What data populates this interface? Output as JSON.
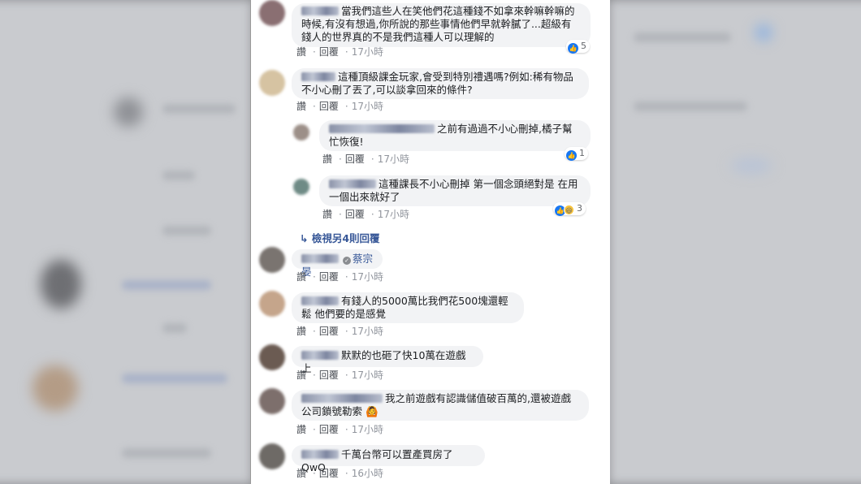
{
  "actions": {
    "like": "讚",
    "reply": "回覆"
  },
  "comments": [
    {
      "text": "當我們這些人在笑他們花這種錢不如拿來幹嘛幹嘛的時候,有沒有想過,你所說的那些事情他們早就幹膩了...超級有錢人的世界真的不是我們這種人可以理解的",
      "time": "17小時",
      "reactions": "5"
    },
    {
      "text": "這種頂級課金玩家,會受到特別禮遇嗎?例如:稀有物品不小心刪了丟了,可以談拿回來的條件?",
      "time": "17小時"
    },
    {
      "text": "之前有過過不小心刪掉,橘子幫忙恢復!",
      "time": "17小時",
      "reactions": "1"
    },
    {
      "text": "這種課長不小心刪掉 第一個念頭絕對是 在用一個出來就好了",
      "time": "17小時",
      "reactions": "3"
    },
    {
      "text": "蔡宗晏",
      "time": "17小時"
    },
    {
      "text": "有錢人的5000萬比我們花500塊還輕鬆 他們要的是感覺",
      "time": "17小時"
    },
    {
      "text": "默默的也砸了快10萬在遊戲上",
      "time": "17小時"
    },
    {
      "text": "我之前遊戲有認識儲值破百萬的,還被遊戲公司鎖號勒索",
      "time": "17小時"
    },
    {
      "text": "千萬台幣可以置產買房了QwQ",
      "time": "16小時"
    }
  ],
  "more_replies": "檢視另4則回覆",
  "colors": {
    "bubble": "#f2f3f5",
    "link": "#385898",
    "like": "#1877f2"
  }
}
